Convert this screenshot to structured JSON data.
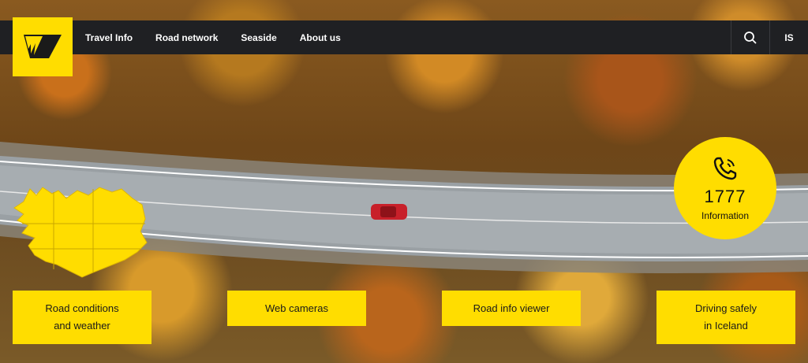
{
  "nav": {
    "links": [
      "Travel Info",
      "Road network",
      "Seaside",
      "About us"
    ],
    "search_icon": "search-icon",
    "language": "IS"
  },
  "logo": {
    "icon": "vegagerdin-logo-icon",
    "color": "#ffdd00"
  },
  "info": {
    "icon": "phone-icon",
    "number": "1777",
    "label": "Information"
  },
  "map": {
    "icon": "iceland-map-icon"
  },
  "tiles": [
    {
      "label": "Road conditions\nand weather"
    },
    {
      "label": "Web cameras"
    },
    {
      "label": "Road info viewer"
    },
    {
      "label": "Driving safely\nin Iceland"
    }
  ],
  "colors": {
    "accent": "#ffdd00",
    "navbar": "#1f2023"
  }
}
